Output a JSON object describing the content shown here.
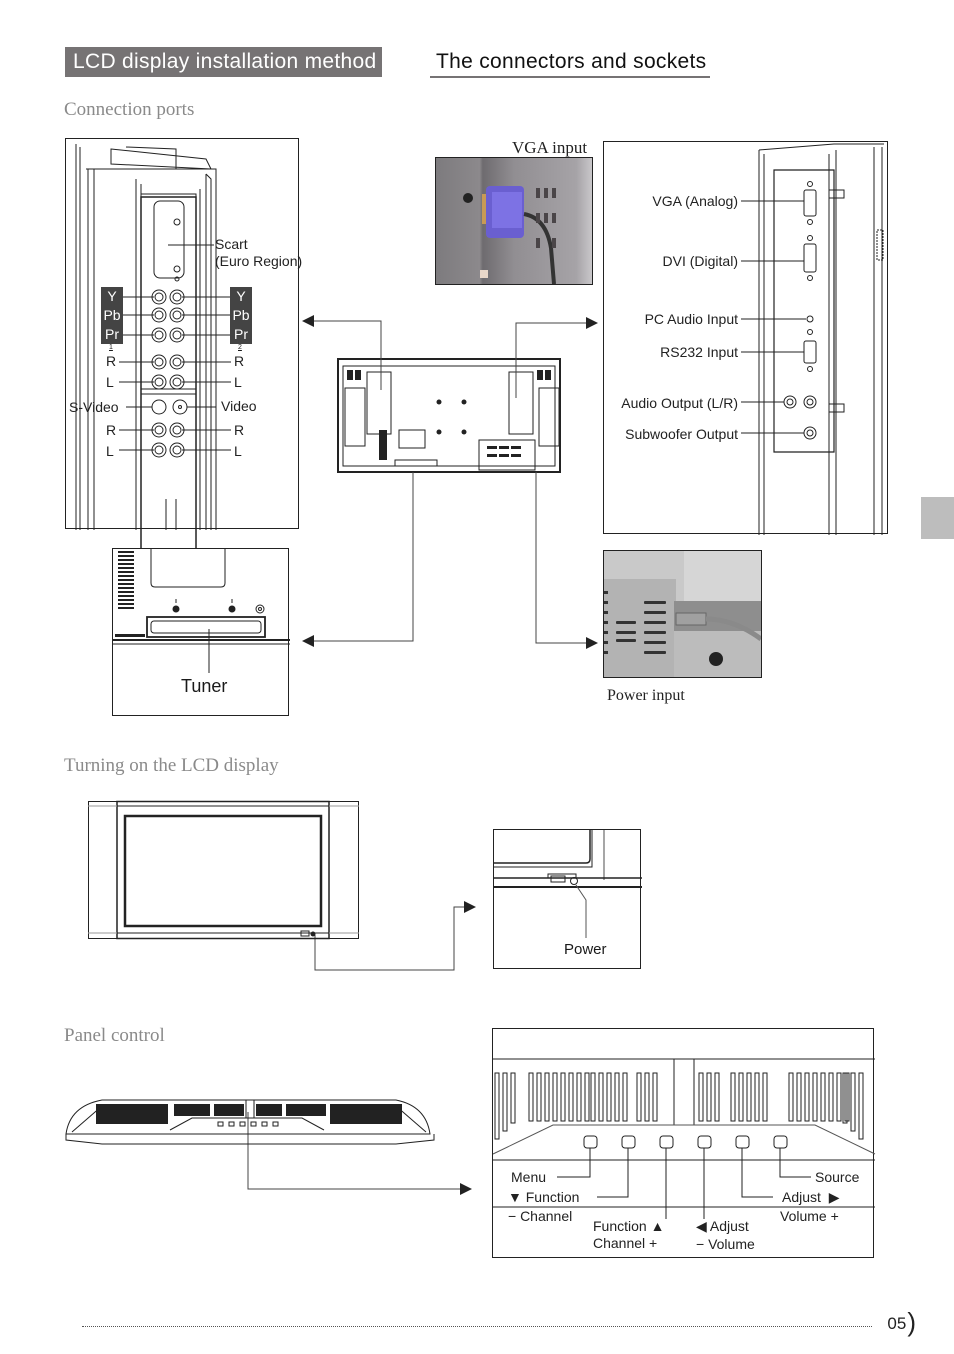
{
  "header": {
    "section": "LCD display installation method",
    "subsection": "The connectors and sockets"
  },
  "connection_ports": {
    "title": "Connection ports",
    "left_panel": {
      "scart_label_1": "Scart",
      "scart_label_2": "(Euro Region)",
      "component_left": [
        "Y",
        "Pb",
        "Pr"
      ],
      "component_right": [
        "Y",
        "Pb",
        "Pr"
      ],
      "component_index_left": "1",
      "component_index_right": "2",
      "audio1_left": [
        "R",
        "L"
      ],
      "audio1_right": [
        "R",
        "L"
      ],
      "svideo": "S-Video",
      "video": "Video",
      "audio2_left": [
        "R",
        "L"
      ],
      "audio2_right": [
        "R",
        "L"
      ]
    },
    "vga_photo_caption": "VGA input",
    "right_panel": {
      "labels": [
        "VGA (Analog)",
        "DVI (Digital)",
        "PC Audio Input",
        "RS232 Input",
        "Audio Output (L/R)",
        "Subwoofer Output"
      ]
    },
    "tuner_label": "Tuner",
    "power_photo_caption": "Power input"
  },
  "turning_on": {
    "title": "Turning on the LCD display",
    "power_label": "Power"
  },
  "panel_control": {
    "title": "Panel control",
    "buttons": [
      {
        "lines": [
          "Menu"
        ]
      },
      {
        "lines": [
          "▼ Function",
          "− Channel"
        ]
      },
      {
        "lines": [
          "Function ▲",
          "Channel +"
        ]
      },
      {
        "lines": [
          "◀ Adjust",
          "− Volume"
        ]
      },
      {
        "lines": [
          "Adjust  ▶",
          "Volume +"
        ]
      },
      {
        "lines": [
          "Source"
        ]
      }
    ]
  },
  "footer": {
    "page_number": "05"
  },
  "colors": {
    "header_bg": "#767374",
    "section_title": "#8a8a8a",
    "side_tab": "#bdbdbd"
  }
}
